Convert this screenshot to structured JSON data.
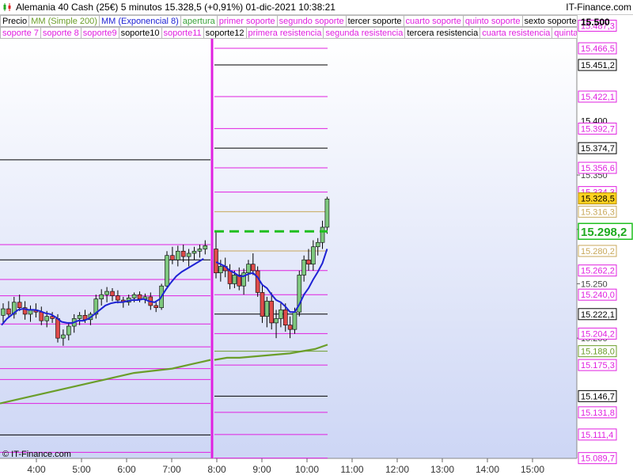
{
  "header": {
    "title": "Alemania 40 Cash (25€)   5 minutos   15.328,5 (+0,91%)   01-dic-2021 10:38:21",
    "top_price": "15.500",
    "brand": "IT-Finance.com"
  },
  "legend": {
    "row1": [
      {
        "label": "Precio",
        "color": "#000000"
      },
      {
        "label": "MM (Simple 200)",
        "color": "#6b9e2a"
      },
      {
        "label": "MM (Exponencial 8)",
        "color": "#1e22d4"
      },
      {
        "label": "apertura",
        "color": "#3aa33a"
      },
      {
        "label": "primer soporte",
        "color": "#e020e0"
      },
      {
        "label": "segundo soporte",
        "color": "#e020e0"
      },
      {
        "label": "tercer soporte",
        "color": "#000000"
      },
      {
        "label": "cuarto soporte",
        "color": "#e020e0"
      },
      {
        "label": "quinto soporte",
        "color": "#e020e0"
      },
      {
        "label": "sexto soporte",
        "color": "#000000"
      }
    ],
    "row2": [
      {
        "label": "soporte 7",
        "color": "#e020e0"
      },
      {
        "label": "soporte 8",
        "color": "#e020e0"
      },
      {
        "label": "soporte9",
        "color": "#e020e0"
      },
      {
        "label": "soporte10",
        "color": "#000000"
      },
      {
        "label": "soporte11",
        "color": "#e020e0"
      },
      {
        "label": "soporte12",
        "color": "#000000"
      },
      {
        "label": "primera resistencia",
        "color": "#e020e0"
      },
      {
        "label": "segunda resistencia",
        "color": "#e020e0"
      },
      {
        "label": "tercera resistencia",
        "color": "#000000"
      },
      {
        "label": "cuarta resistencia",
        "color": "#e020e0"
      },
      {
        "label": "quinta resistencia",
        "color": "#e020e0"
      }
    ]
  },
  "copyright": "© IT-Finance.com",
  "chart_data": {
    "type": "candlestick",
    "timeframe": "5 minutos",
    "instrument": "Alemania 40 Cash (25€)",
    "last_price": 15328.5,
    "change_percent": "+0,91%",
    "timestamp": "01-dic-2021 10:38:21",
    "ylim": [
      15080,
      15500
    ],
    "x_ticks": [
      "4:00",
      "5:00",
      "6:00",
      "7:00",
      "8:00",
      "9:00",
      "10:00",
      "11:00",
      "12:00",
      "13:00",
      "14:00",
      "15:00"
    ],
    "y_ticks": [
      15350,
      15300,
      15250,
      15200
    ],
    "y_tick_labels": [
      "15.350",
      "15.300",
      "15.250",
      "15.200"
    ],
    "current_price_tag": "15.298,2",
    "last_price_tag": "15.328,5",
    "levels_right": [
      {
        "label": "15.487,3",
        "value": 15487.3,
        "color": "#e020e0"
      },
      {
        "label": "15.466,5",
        "value": 15466.5,
        "color": "#e020e0"
      },
      {
        "label": "15.451,2",
        "value": 15451.2,
        "color": "#000000"
      },
      {
        "label": "15.422,1",
        "value": 15422.1,
        "color": "#e020e0"
      },
      {
        "label": "15.400",
        "value": 15400,
        "color": "#000000"
      },
      {
        "label": "15.392,7",
        "value": 15392.7,
        "color": "#e020e0"
      },
      {
        "label": "15.374,7",
        "value": 15374.7,
        "color": "#000000"
      },
      {
        "label": "15.356,6",
        "value": 15356.6,
        "color": "#e020e0"
      },
      {
        "label": "15.334,3",
        "value": 15334.3,
        "color": "#e020e0"
      },
      {
        "label": "15.316,3",
        "value": 15316.3,
        "color": "#c8a85a"
      },
      {
        "label": "15.280,2",
        "value": 15280.2,
        "color": "#c8a85a"
      },
      {
        "label": "15.262,2",
        "value": 15262.2,
        "color": "#e020e0"
      },
      {
        "label": "15.240,0",
        "value": 15240.0,
        "color": "#e020e0"
      },
      {
        "label": "15.222,1",
        "value": 15222.1,
        "color": "#000000"
      },
      {
        "label": "15.204,2",
        "value": 15204.2,
        "color": "#e020e0"
      },
      {
        "label": "15.188,0",
        "value": 15188.0,
        "color": "#6b9e2a"
      },
      {
        "label": "15.175,3",
        "value": 15175.3,
        "color": "#e020e0"
      },
      {
        "label": "15.146,7",
        "value": 15146.7,
        "color": "#000000"
      },
      {
        "label": "15.131,8",
        "value": 15131.8,
        "color": "#e020e0"
      },
      {
        "label": "15.111,4",
        "value": 15111.4,
        "color": "#e020e0"
      },
      {
        "label": "15.089,7",
        "value": 15089.7,
        "color": "#e020e0"
      }
    ],
    "prev_session_levels": [
      {
        "value": 15364,
        "color": "#000000"
      },
      {
        "value": 15286,
        "color": "#e020e0"
      },
      {
        "value": 15272,
        "color": "#000000"
      },
      {
        "value": 15254,
        "color": "#e020e0"
      },
      {
        "value": 15239,
        "color": "#e020e0"
      },
      {
        "value": 15213,
        "color": "#e020e0"
      },
      {
        "value": 15192,
        "color": "#e020e0"
      },
      {
        "value": 15172,
        "color": "#e020e0"
      },
      {
        "value": 15162,
        "color": "#e020e0"
      },
      {
        "value": 15140,
        "color": "#e020e0"
      },
      {
        "value": 15111,
        "color": "#000000"
      },
      {
        "value": 15095,
        "color": "#e020e0"
      }
    ],
    "opening_level": 15298.2,
    "candles_prev": [
      [
        15221,
        15232,
        15214,
        15227
      ],
      [
        15227,
        15234,
        15219,
        15222
      ],
      [
        15222,
        15238,
        15218,
        15233
      ],
      [
        15233,
        15240,
        15225,
        15228
      ],
      [
        15228,
        15234,
        15217,
        15222
      ],
      [
        15222,
        15230,
        15215,
        15226
      ],
      [
        15226,
        15232,
        15219,
        15224
      ],
      [
        15224,
        15229,
        15212,
        15216
      ],
      [
        15216,
        15225,
        15210,
        15220
      ],
      [
        15220,
        15224,
        15214,
        15218
      ],
      [
        15218,
        15222,
        15196,
        15200
      ],
      [
        15200,
        15208,
        15193,
        15203
      ],
      [
        15203,
        15214,
        15198,
        15211
      ],
      [
        15211,
        15222,
        15205,
        15218
      ],
      [
        15218,
        15224,
        15212,
        15221
      ],
      [
        15221,
        15226,
        15214,
        15217
      ],
      [
        15217,
        15224,
        15212,
        15222
      ],
      [
        15222,
        15240,
        15218,
        15236
      ],
      [
        15236,
        15245,
        15230,
        15240
      ],
      [
        15240,
        15247,
        15233,
        15243
      ],
      [
        15243,
        15246,
        15234,
        15239
      ],
      [
        15239,
        15244,
        15232,
        15235
      ],
      [
        15235,
        15238,
        15228,
        15233
      ],
      [
        15233,
        15240,
        15230,
        15237
      ],
      [
        15237,
        15242,
        15233,
        15240
      ],
      [
        15240,
        15243,
        15233,
        15236
      ],
      [
        15236,
        15241,
        15232,
        15238
      ],
      [
        15238,
        15242,
        15226,
        15230
      ],
      [
        15230,
        15234,
        15224,
        15228
      ],
      [
        15228,
        15250,
        15226,
        15248
      ],
      [
        15248,
        15280,
        15246,
        15276
      ],
      [
        15276,
        15284,
        15268,
        15272
      ],
      [
        15272,
        15285,
        15266,
        15280
      ],
      [
        15280,
        15286,
        15270,
        15275
      ],
      [
        15275,
        15282,
        15266,
        15278
      ],
      [
        15278,
        15284,
        15272,
        15280
      ],
      [
        15280,
        15286,
        15274,
        15282
      ],
      [
        15282,
        15290,
        15277,
        15285
      ]
    ],
    "candles_session": [
      [
        15282,
        15298,
        15255,
        15260
      ],
      [
        15260,
        15272,
        15252,
        15266
      ],
      [
        15266,
        15274,
        15256,
        15262
      ],
      [
        15262,
        15268,
        15245,
        15250
      ],
      [
        15250,
        15262,
        15246,
        15258
      ],
      [
        15258,
        15265,
        15244,
        15248
      ],
      [
        15248,
        15264,
        15240,
        15260
      ],
      [
        15260,
        15272,
        15252,
        15268
      ],
      [
        15268,
        15278,
        15258,
        15262
      ],
      [
        15262,
        15266,
        15238,
        15242
      ],
      [
        15242,
        15250,
        15214,
        15220
      ],
      [
        15220,
        15238,
        15210,
        15234
      ],
      [
        15234,
        15242,
        15208,
        15214
      ],
      [
        15214,
        15226,
        15200,
        15218
      ],
      [
        15218,
        15232,
        15210,
        15226
      ],
      [
        15226,
        15232,
        15206,
        15212
      ],
      [
        15212,
        15220,
        15200,
        15208
      ],
      [
        15208,
        15228,
        15204,
        15224
      ],
      [
        15224,
        15262,
        15220,
        15258
      ],
      [
        15258,
        15276,
        15252,
        15272
      ],
      [
        15272,
        15282,
        15262,
        15268
      ],
      [
        15268,
        15290,
        15262,
        15284
      ],
      [
        15284,
        15292,
        15276,
        15288
      ],
      [
        15288,
        15308,
        15282,
        15302
      ],
      [
        15302,
        15330,
        15296,
        15328
      ]
    ],
    "ema8_prev": [
      15212,
      15218,
      15222,
      15226,
      15227,
      15226,
      15226,
      15225,
      15223,
      15222,
      15219,
      15215,
      15214,
      15214,
      15216,
      15216,
      15218,
      15222,
      15226,
      15230,
      15232,
      15233,
      15233,
      15234,
      15235,
      15235,
      15236,
      15234,
      15233,
      15236,
      15244,
      15251,
      15257,
      15261,
      15264,
      15267,
      15270,
      15273
    ],
    "ema8_session": [
      15270,
      15268,
      15266,
      15262,
      15260,
      15257,
      15257,
      15259,
      15260,
      15256,
      15249,
      15246,
      15240,
      15235,
      15233,
      15229,
      15224,
      15224,
      15231,
      15240,
      15246,
      15254,
      15261,
      15269,
      15282
    ],
    "sma200_prev": [
      15140,
      15144,
      15148,
      15152,
      15156,
      15160,
      15164,
      15168,
      15170,
      15172,
      15176,
      15180
    ],
    "sma200_session": [
      15180,
      15182,
      15182,
      15183,
      15184,
      15185,
      15186,
      15188,
      15190,
      15194
    ]
  }
}
